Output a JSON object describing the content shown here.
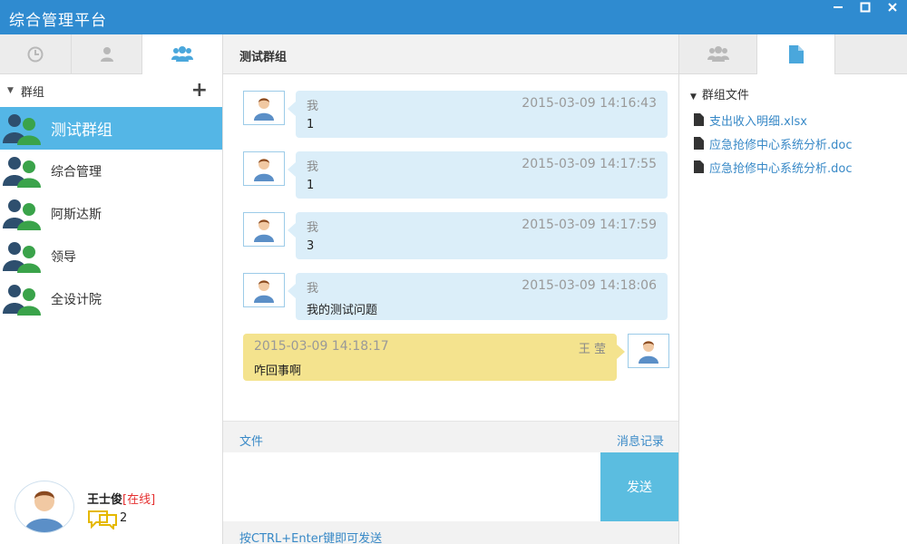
{
  "window": {
    "title": "综合管理平台",
    "controls": [
      "minimize",
      "maximize",
      "close"
    ]
  },
  "left_panel": {
    "tabs": [
      {
        "icon": "clock-icon",
        "active": false
      },
      {
        "icon": "user-icon",
        "active": false
      },
      {
        "icon": "group-icon",
        "active": true
      }
    ],
    "group_header": "群组",
    "groups": [
      {
        "name": "测试群组",
        "active": true
      },
      {
        "name": "综合管理",
        "active": false
      },
      {
        "name": "阿斯达斯",
        "active": false
      },
      {
        "name": "领导",
        "active": false
      },
      {
        "name": "全设计院",
        "active": false
      }
    ],
    "user": {
      "name": "王士俊",
      "status": "[在线]",
      "message_count": "2"
    }
  },
  "chat": {
    "title": "测试群组",
    "messages": [
      {
        "sender": "我",
        "time": "2015-03-09 14:16:43",
        "text": "1",
        "mine": false
      },
      {
        "sender": "我",
        "time": "2015-03-09 14:17:55",
        "text": "1",
        "mine": false
      },
      {
        "sender": "我",
        "time": "2015-03-09 14:17:59",
        "text": "3",
        "mine": false
      },
      {
        "sender": "我",
        "time": "2015-03-09 14:18:06",
        "text": "我的测试问题",
        "mine": false
      },
      {
        "sender": "王 莹",
        "time": "2015-03-09 14:18:17",
        "text": "咋回事啊",
        "mine": true
      }
    ],
    "toolbar": {
      "file_label": "文件",
      "history_label": "消息记录"
    },
    "input_value": "",
    "send_label": "发送",
    "hint": "按CTRL+Enter键即可发送"
  },
  "right_panel": {
    "tabs": [
      {
        "icon": "group-icon",
        "active": false
      },
      {
        "icon": "file-icon",
        "active": true
      }
    ],
    "files_header": "群组文件",
    "files": [
      {
        "name": "支出收入明细.xlsx"
      },
      {
        "name": "应急抢修中心系统分析.doc"
      },
      {
        "name": "应急抢修中心系统分析.doc"
      }
    ]
  },
  "colors": {
    "titlebar": "#2f8bd0",
    "active_item": "#54b6e6",
    "bubble_other": "#dbeef9",
    "bubble_mine": "#f4e38e",
    "send_button": "#5bbde0",
    "link": "#3889c7",
    "status_online": "#e53030"
  }
}
